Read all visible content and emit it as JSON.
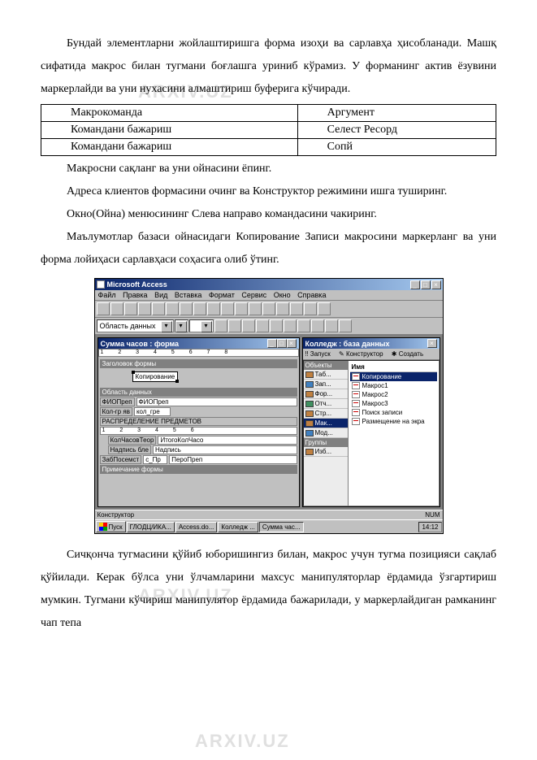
{
  "watermark": "ARXIV.UZ",
  "paragraphs": {
    "p1": "Бундай элементларни жойлаштиришга форма изоҳи ва сарлавҳа ҳисобланади. Машқ сифатида макрос билан тугмани боғлашга уриниб кўрамиз. У форманинг актив ёзувини маркерлайди ва уни нухасини алмаштириш буферига кўчиради.",
    "p2": "Макросни сақланг ва уни ойнасини ёпинг.",
    "p3": "Адреса клиентов формасини очинг ва Конструктор режимини ишга туширинг.",
    "p4": "Окно(Ойна) менюсининг Слева направо командасини чакиринг.",
    "p5": "Маълумотлар базаси ойнасидаги Копирование Записи макросини маркерланг ва уни форма лойиҳаси сарлавҳаси соҳасига олиб ўтинг.",
    "p6": "Сичқонча тугмасини қўйиб юборишингиз билан, макрос учун тугма позицияси сақлаб қўйилади. Керак бўлса уни ўлчамларини махсус манипуляторлар ёрдамида ўзгартириш мумкин. Тугмани кўчириш манипулятор ёрдамида бажарилади, у маркерлайдиган рамканинг чап тепа"
  },
  "table": {
    "rows": [
      {
        "c1": "Макрокоманда",
        "c2": "Аргумент"
      },
      {
        "c1": "Командани бажариш",
        "c2": "Селест Ресорд"
      },
      {
        "c1": "Командани бажариш",
        "c2": "Сопй"
      }
    ]
  },
  "app": {
    "title": "Microsoft Access",
    "menu": [
      "Файл",
      "Правка",
      "Вид",
      "Вставка",
      "Формат",
      "Сервис",
      "Окно",
      "Справка"
    ],
    "combo_area": "Область данных",
    "form_window_title": "Сумма часов : форма",
    "db_window_title": "Колледж : база данных",
    "db_tabs": {
      "open": "Запуск",
      "design": "Конструктор",
      "create": "Создать"
    },
    "sections": {
      "header": "Заголовок формы",
      "detail": "Область данных",
      "footer": "Примечание формы"
    },
    "copy_button": "Копирование",
    "fields": {
      "f1_label": "ФИОПреп",
      "f1_val": "ФИОПреп",
      "f2_label": "Кол-гр яв",
      "f2_val": "кол_гре",
      "f3_label": "РАСПРЕДЕЛЕНИЕ ПРЕДМЕТОВ",
      "f4_label": "КолЧасовТеор",
      "f4_val": "ИтогоКолЧасо",
      "f5_label": "Надпись бле",
      "f5_val": "Надпись",
      "f6_label": "ЗабПосемст",
      "f6_mid": "с_Пр",
      "f6_val": "ПероПреп"
    },
    "objects_header": "Объекты",
    "objects": [
      {
        "label": "Таб..."
      },
      {
        "label": "Зап..."
      },
      {
        "label": "Фор..."
      },
      {
        "label": "Отч..."
      },
      {
        "label": "Стр..."
      },
      {
        "label": "Мак..."
      },
      {
        "label": "Мод..."
      }
    ],
    "groups_header": "Группы",
    "group_item": "Изб...",
    "list_header": "Имя",
    "list": [
      "Копирование",
      "Макрос1",
      "Макрос2",
      "Макрос3",
      "Поиск записи",
      "Размещение на экра"
    ],
    "status": "Конструктор",
    "status_right": "NUM",
    "taskbar": {
      "start": "Пуск",
      "items": [
        "ГЛОДЦ/ИКА...",
        "Access.do...",
        "Колледж ...",
        "Сумма час..."
      ],
      "time": "14:12"
    }
  }
}
